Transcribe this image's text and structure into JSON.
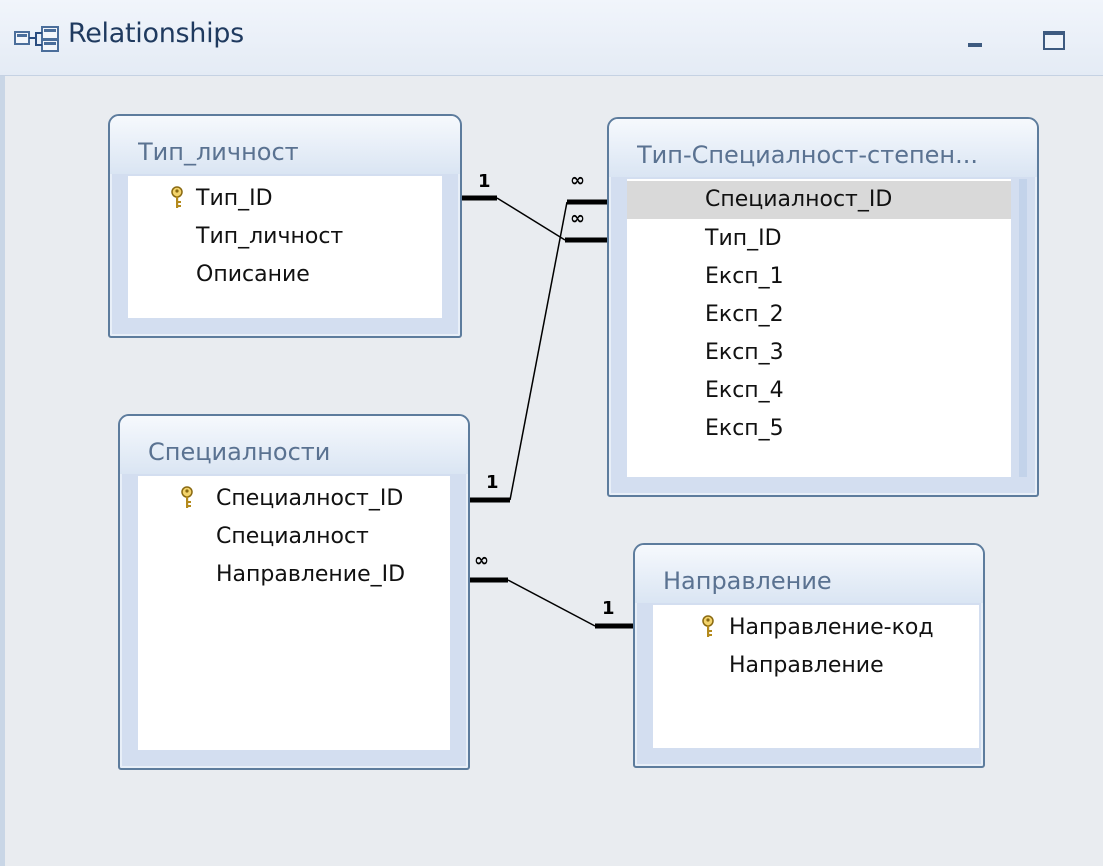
{
  "window": {
    "title": "Relationships",
    "controls": [
      "minimize",
      "maximize"
    ]
  },
  "tables": {
    "tip_lichnost": {
      "name": "Тип_личност",
      "fields": [
        {
          "label": "Тип_ID",
          "primary_key": true
        },
        {
          "label": "Тип_личност",
          "primary_key": false
        },
        {
          "label": "Описание",
          "primary_key": false
        }
      ]
    },
    "tip_spec_stepen": {
      "name": "Тип-Специалност-степен...",
      "fields": [
        {
          "label": "Специалност_ID",
          "primary_key": false,
          "selected": true
        },
        {
          "label": "Тип_ID",
          "primary_key": false
        },
        {
          "label": "Експ_1",
          "primary_key": false
        },
        {
          "label": "Експ_2",
          "primary_key": false
        },
        {
          "label": "Експ_3",
          "primary_key": false
        },
        {
          "label": "Експ_4",
          "primary_key": false
        },
        {
          "label": "Експ_5",
          "primary_key": false
        }
      ]
    },
    "specialnosti": {
      "name": "Специалности",
      "fields": [
        {
          "label": "Специалност_ID",
          "primary_key": true
        },
        {
          "label": "Специалност",
          "primary_key": false
        },
        {
          "label": "Направление_ID",
          "primary_key": false
        }
      ]
    },
    "napravlenie": {
      "name": "Направление",
      "fields": [
        {
          "label": "Направление-код",
          "primary_key": true
        },
        {
          "label": "Направление",
          "primary_key": false
        }
      ]
    }
  },
  "relationships": [
    {
      "from": "Тип_личност.Тип_ID",
      "to": "Тип-Специалност-степен.Тип_ID",
      "from_card": "1",
      "to_card": "∞"
    },
    {
      "from": "Специалности.Специалност_ID",
      "to": "Тип-Специалност-степен.Специалност_ID",
      "from_card": "1",
      "to_card": "∞"
    },
    {
      "from": "Направление.Направление-код",
      "to": "Специалности.Направление_ID",
      "from_card": "1",
      "to_card": "∞"
    }
  ],
  "cardinality": {
    "one": "1",
    "many": "∞"
  },
  "colors": {
    "canvas": "#e9ecf0",
    "table_frame": "#5d7c9d",
    "table_title_text": "#5a7291",
    "selected_row": "#d9d9d9"
  }
}
